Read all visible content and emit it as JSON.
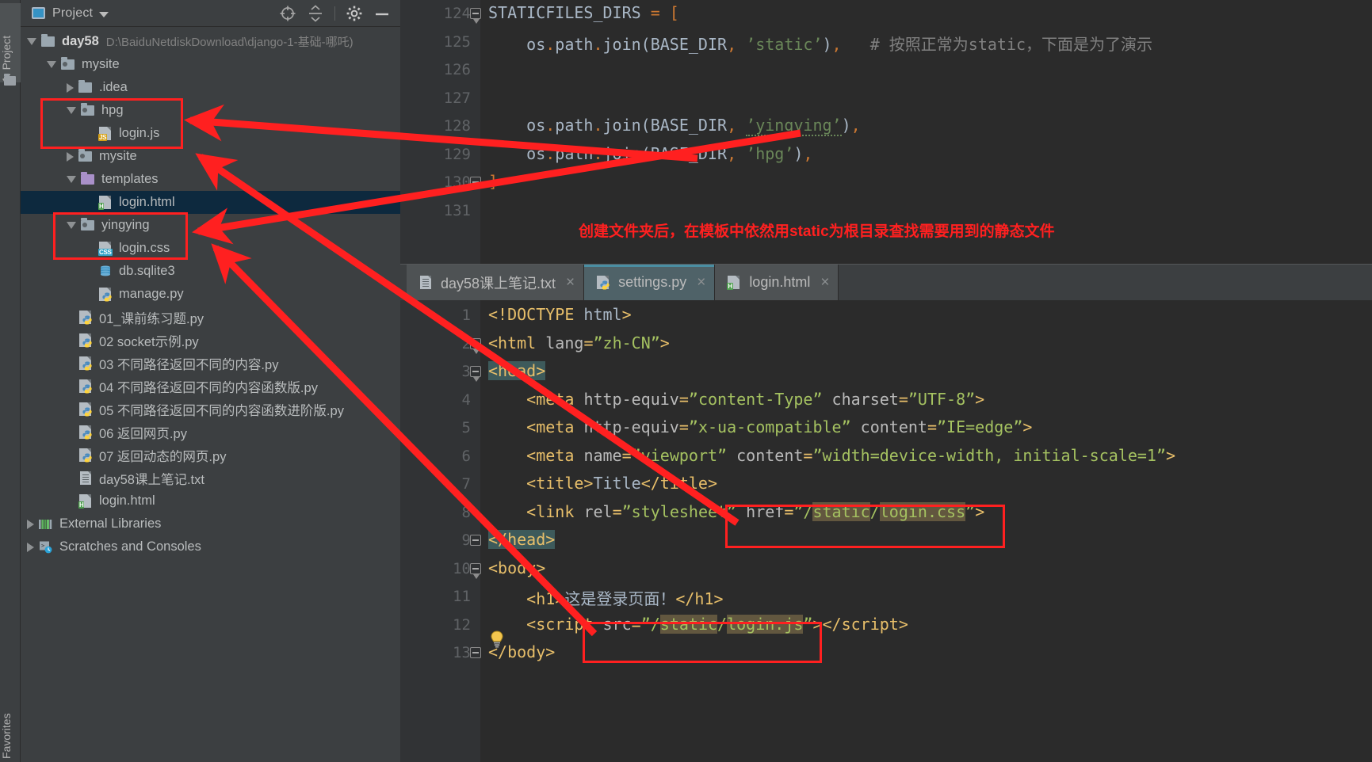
{
  "window": {
    "left_strip_top_label": "1: Project",
    "left_strip_bottom_label": "Favorites"
  },
  "project_panel": {
    "title": "Project",
    "icons": [
      "target-icon",
      "collapse-all-icon",
      "gear-icon",
      "minimize-icon"
    ],
    "tree": [
      {
        "indent": 0,
        "arrow": "down",
        "icon": "folder-plain",
        "label": "day58",
        "bold": true,
        "path": "D:\\BaiduNetdiskDownload\\django-1-基础-哪吒)",
        "selected": false
      },
      {
        "indent": 1,
        "arrow": "down",
        "icon": "folder-module",
        "label": "mysite",
        "bold": false,
        "path": "",
        "selected": false
      },
      {
        "indent": 2,
        "arrow": "right",
        "icon": "folder-plain",
        "label": ".idea",
        "bold": false,
        "path": "",
        "selected": false
      },
      {
        "indent": 2,
        "arrow": "down",
        "icon": "folder-module",
        "label": "hpg",
        "bold": false,
        "path": "",
        "selected": false
      },
      {
        "indent": 3,
        "arrow": "none",
        "icon": "file-js",
        "label": "login.js",
        "bold": false,
        "path": "",
        "selected": false
      },
      {
        "indent": 2,
        "arrow": "right",
        "icon": "folder-module",
        "label": "mysite",
        "bold": false,
        "path": "",
        "selected": false
      },
      {
        "indent": 2,
        "arrow": "down",
        "icon": "folder-purple",
        "label": "templates",
        "bold": false,
        "path": "",
        "selected": false
      },
      {
        "indent": 3,
        "arrow": "none",
        "icon": "file-html",
        "label": "login.html",
        "bold": false,
        "path": "",
        "selected": true
      },
      {
        "indent": 2,
        "arrow": "down",
        "icon": "folder-module",
        "label": "yingying",
        "bold": false,
        "path": "",
        "selected": false
      },
      {
        "indent": 3,
        "arrow": "none",
        "icon": "file-css",
        "label": "login.css",
        "bold": false,
        "path": "",
        "selected": false
      },
      {
        "indent": 3,
        "arrow": "none",
        "icon": "file-db",
        "label": "db.sqlite3",
        "bold": false,
        "path": "",
        "selected": false
      },
      {
        "indent": 3,
        "arrow": "none",
        "icon": "file-py",
        "label": "manage.py",
        "bold": false,
        "path": "",
        "selected": false
      },
      {
        "indent": 2,
        "arrow": "none",
        "icon": "file-py",
        "label": "01_课前练习题.py",
        "bold": false,
        "path": "",
        "selected": false
      },
      {
        "indent": 2,
        "arrow": "none",
        "icon": "file-py",
        "label": "02 socket示例.py",
        "bold": false,
        "path": "",
        "selected": false
      },
      {
        "indent": 2,
        "arrow": "none",
        "icon": "file-py",
        "label": "03 不同路径返回不同的内容.py",
        "bold": false,
        "path": "",
        "selected": false
      },
      {
        "indent": 2,
        "arrow": "none",
        "icon": "file-py",
        "label": "04 不同路径返回不同的内容函数版.py",
        "bold": false,
        "path": "",
        "selected": false
      },
      {
        "indent": 2,
        "arrow": "none",
        "icon": "file-py",
        "label": "05 不同路径返回不同的内容函数进阶版.py",
        "bold": false,
        "path": "",
        "selected": false
      },
      {
        "indent": 2,
        "arrow": "none",
        "icon": "file-py",
        "label": "06 返回网页.py",
        "bold": false,
        "path": "",
        "selected": false
      },
      {
        "indent": 2,
        "arrow": "none",
        "icon": "file-py",
        "label": "07 返回动态的网页.py",
        "bold": false,
        "path": "",
        "selected": false
      },
      {
        "indent": 2,
        "arrow": "none",
        "icon": "file-txt",
        "label": "day58课上笔记.txt",
        "bold": false,
        "path": "",
        "selected": false
      },
      {
        "indent": 2,
        "arrow": "none",
        "icon": "file-html",
        "label": "login.html",
        "bold": false,
        "path": "",
        "selected": false
      },
      {
        "indent": 0,
        "arrow": "right",
        "icon": "ext-libraries",
        "label": "External Libraries",
        "bold": false,
        "path": "",
        "selected": false
      },
      {
        "indent": 0,
        "arrow": "right",
        "icon": "scratches",
        "label": "Scratches and Consoles",
        "bold": false,
        "path": "",
        "selected": false
      }
    ]
  },
  "editor_top": {
    "file": "settings.py",
    "line_numbers": [
      "124",
      "125",
      "126",
      "127",
      "128",
      "129",
      "130",
      "131"
    ],
    "lines": [
      "STATICFILES_DIRS = [",
      "    os.path.join(BASE_DIR, 'static'),   # 按照正常为static，下面是为了演示",
      "",
      "",
      "    os.path.join(BASE_DIR, 'yingying'),",
      "    os.path.join(BASE_DIR, 'hpg'),",
      "]",
      ""
    ],
    "annotation": "创建文件夹后，在模板中依然用static为根目录查找需要用到的静态文件"
  },
  "tabs": [
    {
      "label": "day58课上笔记.txt",
      "icon": "file-txt",
      "active": false,
      "close": "×"
    },
    {
      "label": "settings.py",
      "icon": "file-py",
      "active": true,
      "close": "×"
    },
    {
      "label": "login.html",
      "icon": "file-html",
      "active": false,
      "close": "×"
    }
  ],
  "editor_bottom": {
    "file": "login.html",
    "line_numbers": [
      "1",
      "2",
      "3",
      "4",
      "5",
      "6",
      "7",
      "8",
      "9",
      "10",
      "11",
      "12",
      "13"
    ],
    "lines": [
      "<!DOCTYPE html>",
      "<html lang=\"zh-CN\">",
      "<head>",
      "    <meta http-equiv=\"content-Type\" charset=\"UTF-8\">",
      "    <meta http-equiv=\"x-ua-compatible\" content=\"IE=edge\">",
      "    <meta name=\"viewport\" content=\"width=device-width, initial-scale=1\">",
      "    <title>Title</title>",
      "    <link rel=\"stylesheet\" href=\"/static/login.css\">",
      "</head>",
      "<body>",
      "    <h1>这是登录页面！</h1>",
      "    <script src=\"/static/login.js\"></script>",
      "</body>"
    ]
  },
  "colors": {
    "annotation_red": "#ff2020",
    "selection_blue": "#0d293e",
    "tab_active": "#4f6268",
    "accent": "#4a8ea2"
  }
}
